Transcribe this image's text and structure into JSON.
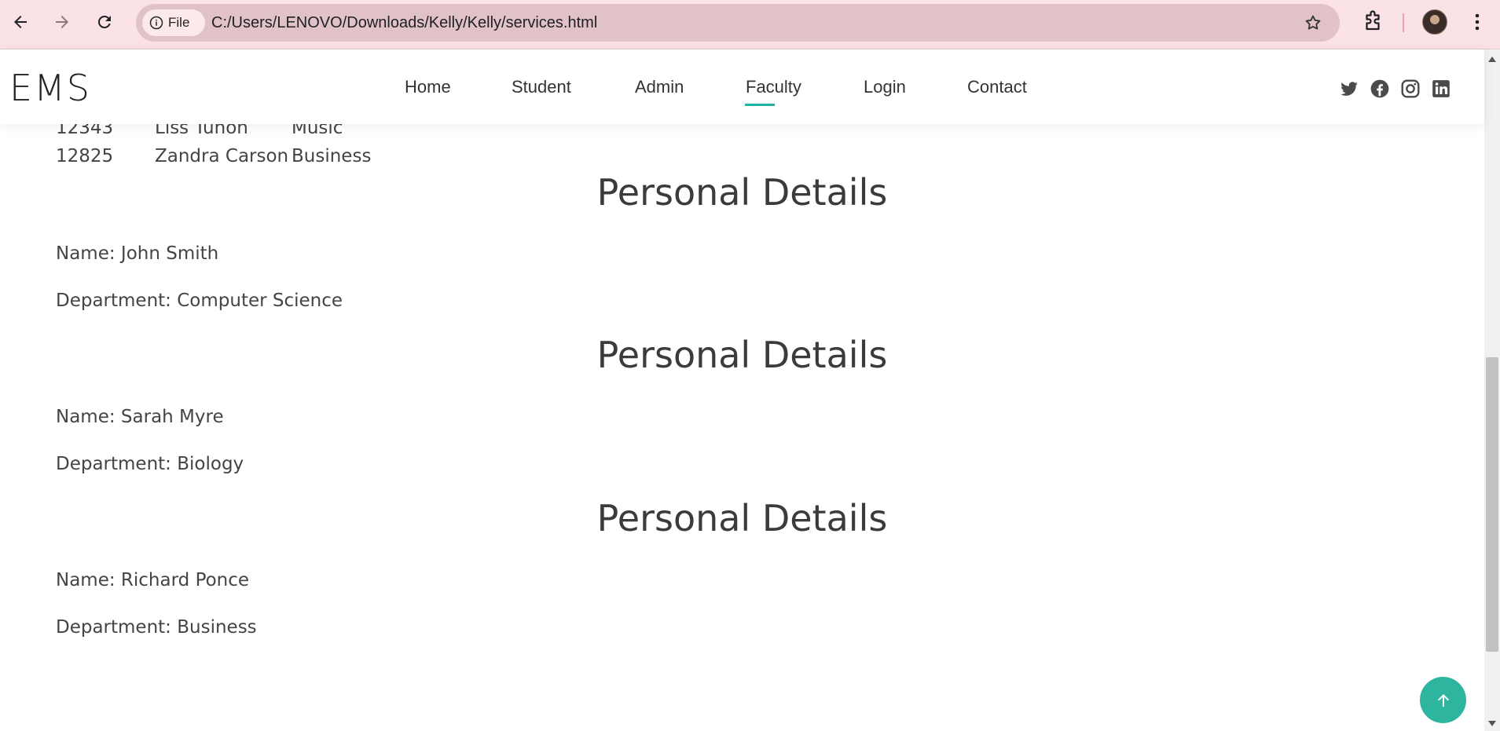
{
  "browser": {
    "chip_label": "File",
    "url": "C:/Users/LENOVO/Downloads/Kelly/Kelly/services.html",
    "icons": [
      "back-arrow-icon",
      "forward-arrow-icon",
      "reload-icon",
      "info-icon",
      "star-icon",
      "extensions-icon",
      "profile-avatar",
      "more-menu-icon"
    ]
  },
  "site": {
    "logo": "EMS",
    "nav": [
      {
        "label": "Home"
      },
      {
        "label": "Student"
      },
      {
        "label": "Admin"
      },
      {
        "label": "Faculty",
        "active": true
      },
      {
        "label": "Login"
      },
      {
        "label": "Contact"
      }
    ],
    "social_icons": [
      "twitter-icon",
      "facebook-icon",
      "instagram-icon",
      "linkedin-icon"
    ],
    "accent_color": "#1fb5a2"
  },
  "table": {
    "rows": [
      {
        "id": "12343",
        "name": "Liss Tuhon",
        "department": "Music"
      },
      {
        "id": "12825",
        "name": "Zandra Carson",
        "department": "Business"
      }
    ]
  },
  "details": [
    {
      "heading": "Personal Details",
      "name": "Name: John Smith",
      "department": "Department: Computer Science"
    },
    {
      "heading": "Personal Details",
      "name": "Name: Sarah Myre",
      "department": "Department: Biology"
    },
    {
      "heading": "Personal Details",
      "name": "Name: Richard Ponce",
      "department": "Department: Business"
    }
  ],
  "back_to_top_icon": "arrow-up-icon"
}
